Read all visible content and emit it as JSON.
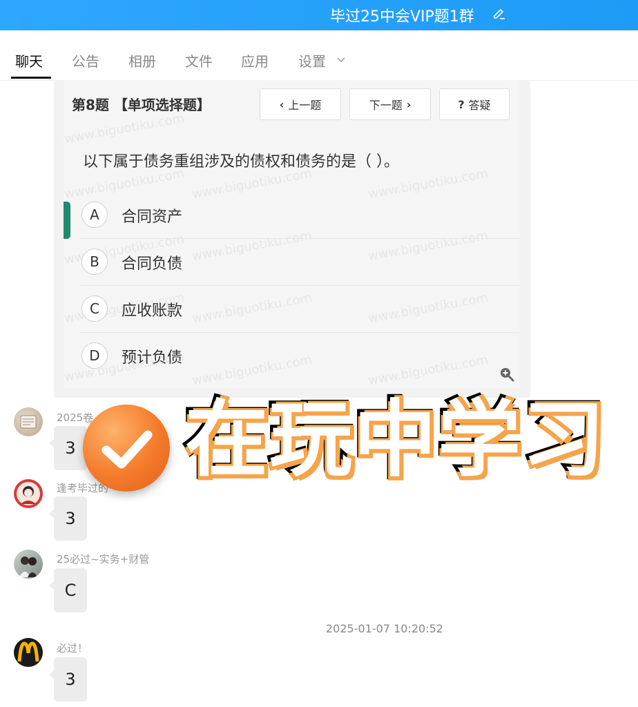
{
  "header": {
    "title": "毕过25中会VIP题1群"
  },
  "tabs": [
    {
      "label": "聊天",
      "active": true
    },
    {
      "label": "公告"
    },
    {
      "label": "相册"
    },
    {
      "label": "文件"
    },
    {
      "label": "应用"
    },
    {
      "label": "设置"
    }
  ],
  "question": {
    "title": "第8题 【单项选择题】",
    "prev_label": "上一题",
    "next_label": "下一题",
    "help_label": "答疑",
    "text": "以下属于债务重组涉及的债权和债务的是（        ）。",
    "options": [
      {
        "letter": "A",
        "text": "合同资产"
      },
      {
        "letter": "B",
        "text": "合同负债"
      },
      {
        "letter": "C",
        "text": "应收账款"
      },
      {
        "letter": "D",
        "text": "预计负债"
      }
    ],
    "watermark": "www.biguotiku.com"
  },
  "messages": [
    {
      "sender": "2025卷",
      "text": "3"
    },
    {
      "sender": "逢考毕过的",
      "text": "3"
    },
    {
      "sender": "25必过~实务+财管",
      "text": "C"
    },
    {
      "sender": "必过！",
      "text": "3"
    }
  ],
  "timestamp": "2025-01-07 10:20:52",
  "overlay": {
    "banner": "在玩中学习"
  },
  "colors": {
    "header_blue": "#1d9bf6",
    "badge_orange": "#f47a2a",
    "banner_outline": "#f6a44a"
  }
}
